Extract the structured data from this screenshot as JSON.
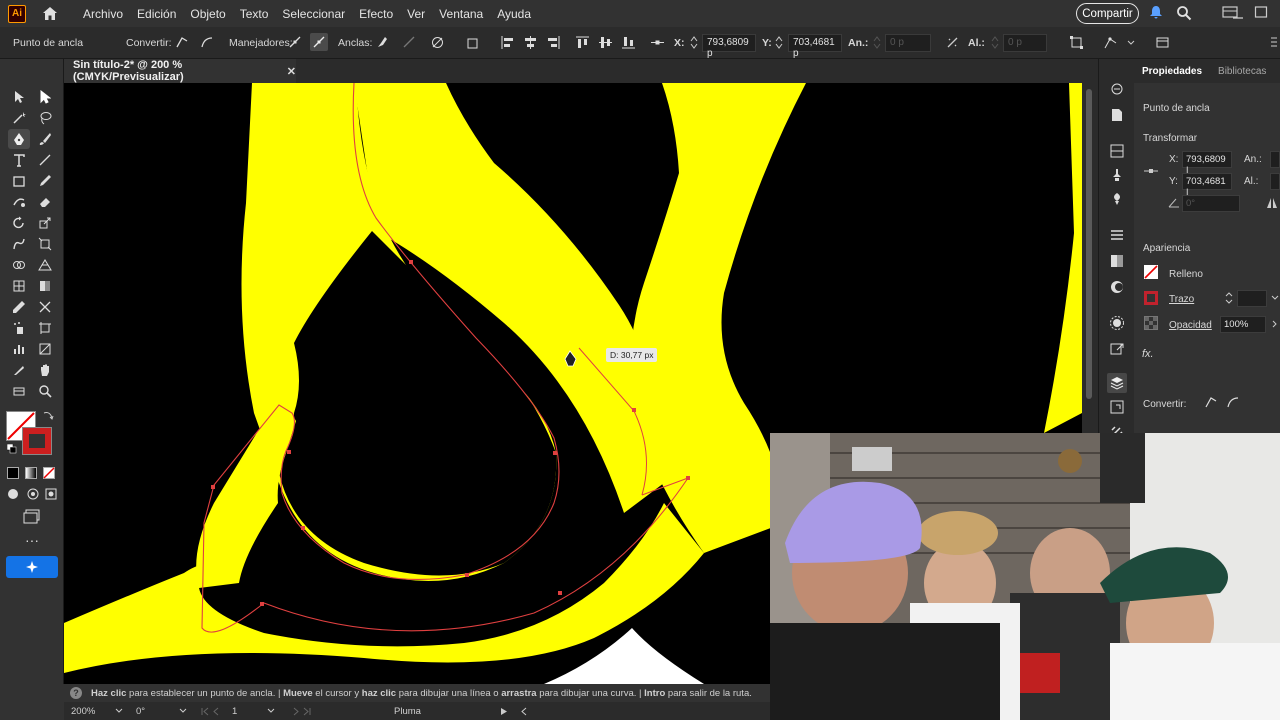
{
  "app": {
    "logo": "Ai",
    "colors": {
      "accent": "#1473e6",
      "artwork_yellow": "#ffff00",
      "path": "#e03a3a"
    }
  },
  "menu": {
    "items": [
      "Archivo",
      "Edición",
      "Objeto",
      "Texto",
      "Seleccionar",
      "Efecto",
      "Ver",
      "Ventana",
      "Ayuda"
    ],
    "share_label": "Compartir"
  },
  "control": {
    "context_label": "Punto de ancla",
    "convert_label": "Convertir:",
    "handles_label": "Manejadores:",
    "anchors_label": "Anclas:",
    "x_label": "X:",
    "x_value": "793,6809 p",
    "y_label": "Y:",
    "y_value": "703,4681 p",
    "w_label": "An.:",
    "w_value": "0 p",
    "h_label": "Al.:",
    "h_value": "0 p"
  },
  "document": {
    "tab_title": "Sin título-2* @ 200 % (CMYK/Previsualizar)",
    "close_glyph": "✕"
  },
  "canvas": {
    "distance_tooltip": "D: 30,77 px"
  },
  "properties": {
    "tab_properties": "Propiedades",
    "tab_libraries": "Bibliotecas",
    "section_title": "Punto de ancla",
    "transform_heading": "Transformar",
    "x_label": "X:",
    "x_value": "793,6809 |",
    "y_label": "Y:",
    "y_value": "703,4681 |",
    "w_label": "An.:",
    "h_label": "Al.:",
    "angle_value": "0°",
    "appearance_heading": "Apariencia",
    "fill_label": "Relleno",
    "stroke_label": "Trazo",
    "opacity_label": "Opacidad",
    "opacity_value": "100%",
    "fx_label": "fx.",
    "convert_label": "Convertir:"
  },
  "hint": {
    "p1_bold": "Haz clic",
    "p2": " para establecer un punto de ancla.  |  ",
    "p3_bold": "Mueve",
    "p4": " el cursor y ",
    "p5_bold": "haz clic",
    "p6": " para dibujar una línea o ",
    "p7_bold": "arrastra",
    "p8": " para dibujar una curva.  |  ",
    "p9_bold": "Intro",
    "p10": " para salir de la ruta."
  },
  "status": {
    "zoom": "200%",
    "rotation": "0°",
    "artboard": "1",
    "tool_name": "Pluma"
  }
}
